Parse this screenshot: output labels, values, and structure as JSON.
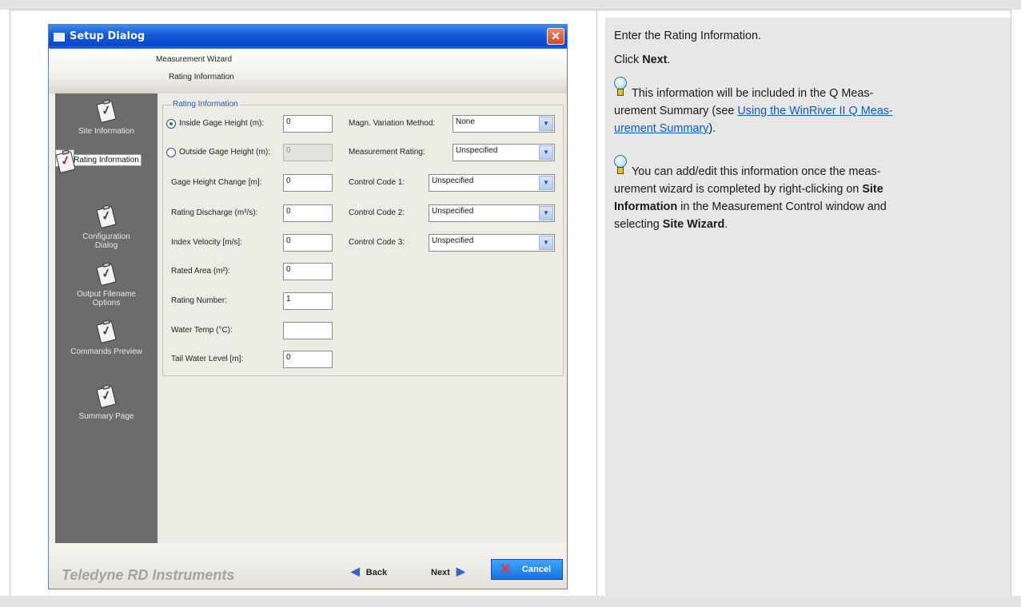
{
  "dialog": {
    "title": "Setup Dialog",
    "close_glyph": "✕",
    "header_line1": "Measurement Wizard",
    "header_line2": "Rating Information"
  },
  "sidebar": {
    "items": [
      {
        "label1": "Site Information",
        "label2": "",
        "icon": "clipboard-check-icon"
      },
      {
        "label1": "Rating Information",
        "label2": "",
        "icon": "clipboard-check-icon",
        "selected": true
      },
      {
        "label1": "Configuration",
        "label2": "Dialog",
        "icon": "clipboard-check-icon"
      },
      {
        "label1": "Output Filename",
        "label2": "Options",
        "icon": "clipboard-check-icon"
      },
      {
        "label1": "Commands Preview",
        "label2": "",
        "icon": "clipboard-check-icon"
      },
      {
        "label1": "Summary Page",
        "label2": "",
        "icon": "clipboard-check-icon"
      }
    ]
  },
  "form": {
    "group_label": "Rating Information",
    "left_fields": [
      {
        "label": "Inside Gage Height (m):",
        "value": "0"
      },
      {
        "label": "Outside Gage Height (m):",
        "value": "0"
      },
      {
        "label": "Gage Height Change [m]:",
        "value": "0"
      },
      {
        "label": "Rating Discharge (m³/s):",
        "value": "0"
      },
      {
        "label": "Index Velocity [m/s]:",
        "value": "0"
      },
      {
        "label": "Rated Area (m²):",
        "value": "0"
      },
      {
        "label": "Rating Number:",
        "value": "1"
      },
      {
        "label": "Water Temp (°C):",
        "value": ""
      },
      {
        "label": "Tail Water Level [m]:",
        "value": "0"
      }
    ],
    "right_fields": [
      {
        "label": "Magn. Variation Method:",
        "value": "None"
      },
      {
        "label": "Measurement Rating:",
        "value": "Unspecified"
      },
      {
        "label": "Control Code 1:",
        "value": "Unspecified"
      },
      {
        "label": "Control Code 2:",
        "value": "Unspecified"
      },
      {
        "label": "Control Code 3:",
        "value": "Unspecified"
      }
    ],
    "dropdown_arrow": "▼"
  },
  "footer": {
    "brand": "Teledyne RD Instruments",
    "back_label": "Back",
    "next_label": "Next",
    "cancel_label": "Cancel",
    "back_arrow": "◀",
    "next_arrow": "▶",
    "cancel_glyph": "✕"
  },
  "panel": {
    "line1": "Enter the Rating Information.",
    "click_prefix": "Click ",
    "click_bold": "Next",
    "click_suffix": ".",
    "tip1_a": "This information will be included in the Q Meas-",
    "tip1_b": "urement Summary (see ",
    "tip1_link1": "Using the WinRiver II Q Meas-",
    "tip1_link2": "urement Summary",
    "tip1_end": ").",
    "tip2_a": "You can add/edit this information once the meas-",
    "tip2_b": "urement wizard is completed by right-clicking on ",
    "tip2_bold1": "Site",
    "tip2_c_bold": "Information",
    "tip2_c": " in the Measurement Control window and",
    "tip2_d": "selecting ",
    "tip2_bold2": "Site Wizard",
    "tip2_end": "."
  }
}
